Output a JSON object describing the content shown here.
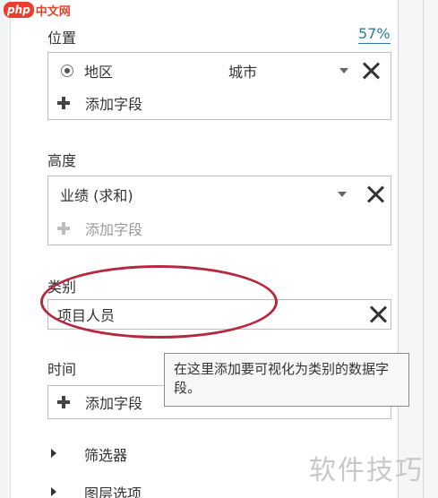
{
  "watermark_top": {
    "logo": "php",
    "text": "中文网"
  },
  "location": {
    "label": "位置",
    "percent": "57%",
    "field": "地区",
    "sub_field": "城市",
    "add_field": "添加字段"
  },
  "height": {
    "label": "高度",
    "field": "业绩 (求和)",
    "add_field": "添加字段"
  },
  "category": {
    "label": "类别",
    "field": "项目人员"
  },
  "tooltip": {
    "text": "在这里添加要可视化为类别的数据字段。"
  },
  "time": {
    "label": "时间",
    "add_field": "添加字段"
  },
  "filters": {
    "label": "筛选器"
  },
  "layer_options": {
    "label": "图层选项"
  },
  "watermark_bottom": {
    "text": "软件技巧"
  },
  "colors": {
    "accent_link": "#2b7a9b",
    "highlight_ellipse": "#b5283e",
    "watermark_red": "#e8402c"
  },
  "icons": [
    "radio-icon",
    "plus-icon",
    "dropdown-caret-icon",
    "close-icon",
    "expand-arrow-icon"
  ]
}
